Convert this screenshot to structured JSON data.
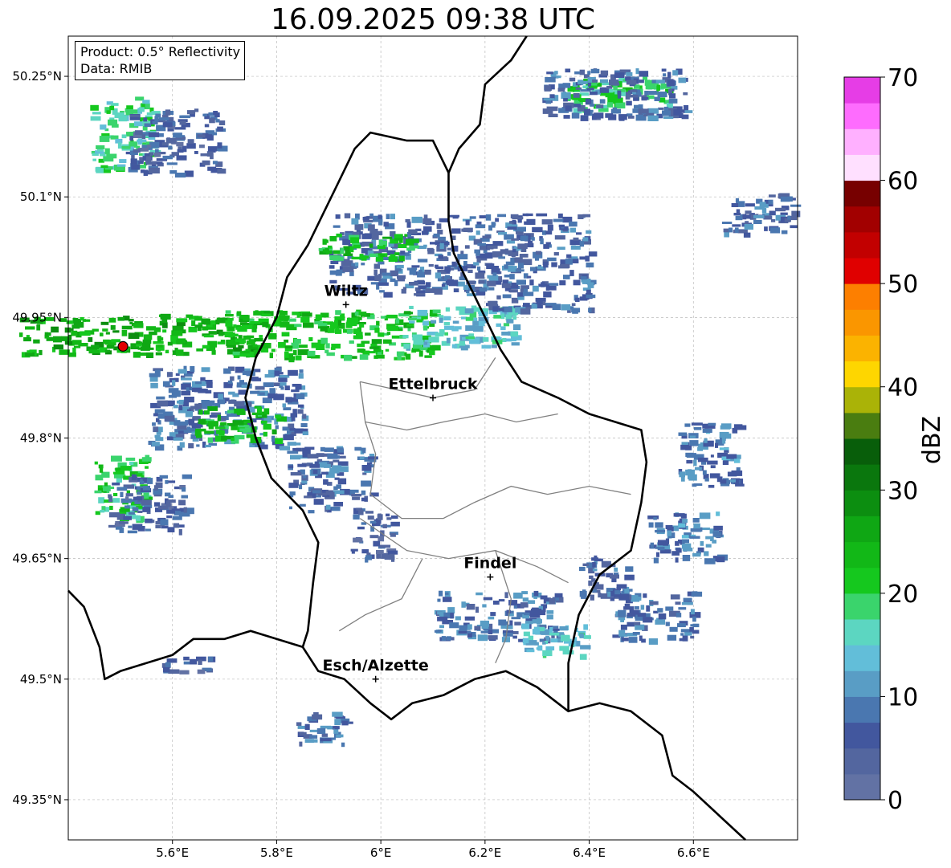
{
  "title": "16.09.2025 09:38 UTC",
  "info_box": {
    "product": "Product: 0.5° Reflectivity",
    "data": "Data: RMIB"
  },
  "chart_data": {
    "type": "heatmap",
    "title": "16.09.2025 09:38 UTC",
    "xlim": [
      5.4,
      6.8
    ],
    "ylim": [
      49.3,
      50.3
    ],
    "x_ticks": [
      {
        "value": 5.6,
        "label": "5.6°E"
      },
      {
        "value": 5.8,
        "label": "5.8°E"
      },
      {
        "value": 6.0,
        "label": "6°E"
      },
      {
        "value": 6.2,
        "label": "6.2°E"
      },
      {
        "value": 6.4,
        "label": "6.4°E"
      },
      {
        "value": 6.6,
        "label": "6.6°E"
      }
    ],
    "y_ticks": [
      {
        "value": 50.25,
        "label": "50.25°N"
      },
      {
        "value": 50.1,
        "label": "50.1°N"
      },
      {
        "value": 49.95,
        "label": "49.95°N"
      },
      {
        "value": 49.8,
        "label": "49.8°N"
      },
      {
        "value": 49.65,
        "label": "49.65°N"
      },
      {
        "value": 49.5,
        "label": "49.5°N"
      },
      {
        "value": 49.35,
        "label": "49.35°N"
      }
    ],
    "grid": true,
    "cities": [
      {
        "name": "Wiltz",
        "lon": 5.933,
        "lat": 49.966
      },
      {
        "name": "Ettelbruck",
        "lon": 6.1,
        "lat": 49.85
      },
      {
        "name": "Findel",
        "lon": 6.21,
        "lat": 49.627
      },
      {
        "name": "Esch/Alzette",
        "lon": 5.99,
        "lat": 49.5
      }
    ],
    "radar_site": {
      "lon": 5.505,
      "lat": 49.914,
      "color": "#e00000"
    },
    "colorbar": {
      "label": "dBZ",
      "min": 0,
      "max": 70,
      "step": 2.5,
      "ticks": [
        {
          "value": 0,
          "label": "0"
        },
        {
          "value": 10,
          "label": "10"
        },
        {
          "value": 20,
          "label": "20"
        },
        {
          "value": 30,
          "label": "30"
        },
        {
          "value": 40,
          "label": "40"
        },
        {
          "value": 50,
          "label": "50"
        },
        {
          "value": 60,
          "label": "60"
        },
        {
          "value": 70,
          "label": "70"
        }
      ],
      "colors": [
        "#6272a4",
        "#53669f",
        "#42579e",
        "#4a77b0",
        "#599dc5",
        "#62bed9",
        "#5cd6c1",
        "#3ad46c",
        "#15c81e",
        "#12b817",
        "#0fa714",
        "#0c8e10",
        "#0a770d",
        "#085e0a",
        "#4a7d10",
        "#aab307",
        "#fed600",
        "#fbb300",
        "#fa9600",
        "#fd7f00",
        "#e00000",
        "#c20000",
        "#a20000",
        "#770000",
        "#ffe0ff",
        "#ffb0ff",
        "#fe6cfe",
        "#e63de6"
      ]
    },
    "reflectivity_areas": [
      {
        "lon": 5.53,
        "lat": 49.93,
        "lon_span": 0.45,
        "lat_span": 0.05,
        "dbz": 25
      },
      {
        "lon": 5.9,
        "lat": 49.93,
        "lon_span": 0.4,
        "lat_span": 0.06,
        "dbz": 22
      },
      {
        "lon": 6.15,
        "lat": 49.94,
        "lon_span": 0.22,
        "lat_span": 0.05,
        "dbz": 14
      },
      {
        "lon": 5.5,
        "lat": 50.18,
        "lon_span": 0.12,
        "lat_span": 0.09,
        "dbz": 18
      },
      {
        "lon": 5.6,
        "lat": 50.17,
        "lon_span": 0.18,
        "lat_span": 0.08,
        "dbz": 6
      },
      {
        "lon": 6.05,
        "lat": 50.03,
        "lon_span": 0.3,
        "lat_span": 0.1,
        "dbz": 7
      },
      {
        "lon": 5.97,
        "lat": 50.04,
        "lon_span": 0.18,
        "lat_span": 0.03,
        "dbz": 22
      },
      {
        "lon": 6.3,
        "lat": 50.02,
        "lon_span": 0.2,
        "lat_span": 0.12,
        "dbz": 7
      },
      {
        "lon": 5.7,
        "lat": 49.84,
        "lon_span": 0.3,
        "lat_span": 0.1,
        "dbz": 8
      },
      {
        "lon": 5.72,
        "lat": 49.82,
        "lon_span": 0.16,
        "lat_span": 0.04,
        "dbz": 22
      },
      {
        "lon": 5.9,
        "lat": 49.75,
        "lon_span": 0.16,
        "lat_span": 0.08,
        "dbz": 7
      },
      {
        "lon": 5.5,
        "lat": 49.74,
        "lon_span": 0.1,
        "lat_span": 0.08,
        "dbz": 20
      },
      {
        "lon": 5.55,
        "lat": 49.72,
        "lon_span": 0.15,
        "lat_span": 0.07,
        "dbz": 6
      },
      {
        "lon": 6.45,
        "lat": 50.23,
        "lon_span": 0.2,
        "lat_span": 0.04,
        "dbz": 20
      },
      {
        "lon": 6.45,
        "lat": 50.23,
        "lon_span": 0.28,
        "lat_span": 0.06,
        "dbz": 7
      },
      {
        "lon": 6.72,
        "lat": 50.08,
        "lon_span": 0.14,
        "lat_span": 0.05,
        "dbz": 7
      },
      {
        "lon": 6.63,
        "lat": 49.78,
        "lon_span": 0.12,
        "lat_span": 0.08,
        "dbz": 9
      },
      {
        "lon": 6.58,
        "lat": 49.68,
        "lon_span": 0.14,
        "lat_span": 0.06,
        "dbz": 9
      },
      {
        "lon": 6.52,
        "lat": 49.58,
        "lon_span": 0.16,
        "lat_span": 0.06,
        "dbz": 8
      },
      {
        "lon": 6.22,
        "lat": 49.58,
        "lon_span": 0.24,
        "lat_span": 0.06,
        "dbz": 8
      },
      {
        "lon": 6.33,
        "lat": 49.55,
        "lon_span": 0.12,
        "lat_span": 0.04,
        "dbz": 14
      },
      {
        "lon": 5.88,
        "lat": 49.44,
        "lon_span": 0.1,
        "lat_span": 0.04,
        "dbz": 8
      },
      {
        "lon": 5.98,
        "lat": 49.68,
        "lon_span": 0.08,
        "lat_span": 0.06,
        "dbz": 6
      },
      {
        "lon": 6.42,
        "lat": 49.63,
        "lon_span": 0.1,
        "lat_span": 0.05,
        "dbz": 7
      },
      {
        "lon": 5.62,
        "lat": 49.52,
        "lon_span": 0.1,
        "lat_span": 0.02,
        "dbz": 6
      }
    ],
    "country_borders": [
      [
        [
          5.4,
          49.61
        ],
        [
          5.43,
          49.59
        ],
        [
          5.46,
          49.54
        ],
        [
          5.47,
          49.5
        ],
        [
          5.5,
          49.51
        ],
        [
          5.55,
          49.52
        ],
        [
          5.6,
          49.53
        ],
        [
          5.64,
          49.55
        ],
        [
          5.7,
          49.55
        ],
        [
          5.75,
          49.56
        ],
        [
          5.8,
          49.55
        ],
        [
          5.85,
          49.54
        ],
        [
          5.88,
          49.51
        ],
        [
          5.93,
          49.5
        ],
        [
          5.98,
          49.47
        ],
        [
          6.02,
          49.45
        ],
        [
          6.06,
          49.47
        ],
        [
          6.12,
          49.48
        ],
        [
          6.18,
          49.5
        ],
        [
          6.24,
          49.51
        ],
        [
          6.3,
          49.49
        ],
        [
          6.36,
          49.46
        ],
        [
          6.42,
          49.47
        ],
        [
          6.48,
          49.46
        ],
        [
          6.54,
          49.43
        ],
        [
          6.56,
          49.38
        ],
        [
          6.6,
          49.36
        ],
        [
          6.65,
          49.33
        ],
        [
          6.7,
          49.3
        ]
      ],
      [
        [
          6.36,
          49.46
        ],
        [
          6.36,
          49.52
        ],
        [
          6.38,
          49.58
        ],
        [
          6.42,
          49.63
        ],
        [
          6.48,
          49.66
        ],
        [
          6.5,
          49.72
        ],
        [
          6.51,
          49.77
        ],
        [
          6.5,
          49.81
        ],
        [
          6.45,
          49.82
        ],
        [
          6.4,
          49.83
        ],
        [
          6.34,
          49.85
        ],
        [
          6.27,
          49.87
        ],
        [
          6.23,
          49.91
        ],
        [
          6.2,
          49.95
        ],
        [
          6.17,
          49.99
        ],
        [
          6.14,
          50.03
        ],
        [
          6.13,
          50.07
        ],
        [
          6.13,
          50.13
        ],
        [
          6.15,
          50.16
        ],
        [
          6.19,
          50.19
        ],
        [
          6.2,
          50.24
        ],
        [
          6.25,
          50.27
        ],
        [
          6.28,
          50.3
        ]
      ],
      [
        [
          6.13,
          50.13
        ],
        [
          6.1,
          50.17
        ],
        [
          6.05,
          50.17
        ],
        [
          5.98,
          50.18
        ],
        [
          5.95,
          50.16
        ],
        [
          5.92,
          50.12
        ],
        [
          5.89,
          50.08
        ],
        [
          5.86,
          50.04
        ],
        [
          5.82,
          50.0
        ],
        [
          5.8,
          49.95
        ],
        [
          5.76,
          49.9
        ],
        [
          5.74,
          49.85
        ],
        [
          5.76,
          49.8
        ],
        [
          5.79,
          49.75
        ],
        [
          5.85,
          49.71
        ],
        [
          5.88,
          49.67
        ],
        [
          5.87,
          49.62
        ],
        [
          5.86,
          49.56
        ],
        [
          5.85,
          49.54
        ]
      ]
    ],
    "canton_borders": [
      [
        [
          5.96,
          49.87
        ],
        [
          6.03,
          49.86
        ],
        [
          6.1,
          49.85
        ],
        [
          6.18,
          49.86
        ],
        [
          6.22,
          49.9
        ]
      ],
      [
        [
          5.96,
          49.87
        ],
        [
          5.97,
          49.82
        ],
        [
          6.05,
          49.81
        ],
        [
          6.12,
          49.82
        ],
        [
          6.2,
          49.83
        ],
        [
          6.26,
          49.82
        ],
        [
          6.34,
          49.83
        ]
      ],
      [
        [
          5.97,
          49.82
        ],
        [
          5.99,
          49.78
        ],
        [
          5.98,
          49.73
        ],
        [
          6.04,
          49.7
        ],
        [
          6.12,
          49.7
        ],
        [
          6.18,
          49.72
        ],
        [
          6.25,
          49.74
        ],
        [
          6.32,
          49.73
        ],
        [
          6.4,
          49.74
        ],
        [
          6.48,
          49.73
        ]
      ],
      [
        [
          5.96,
          49.7
        ],
        [
          6.05,
          49.66
        ],
        [
          6.13,
          49.65
        ],
        [
          6.22,
          49.66
        ],
        [
          6.3,
          49.64
        ],
        [
          6.36,
          49.62
        ]
      ],
      [
        [
          6.08,
          49.65
        ],
        [
          6.04,
          49.6
        ],
        [
          5.97,
          49.58
        ],
        [
          5.92,
          49.56
        ]
      ],
      [
        [
          6.22,
          49.66
        ],
        [
          6.25,
          49.6
        ],
        [
          6.24,
          49.55
        ],
        [
          6.22,
          49.52
        ]
      ]
    ]
  }
}
